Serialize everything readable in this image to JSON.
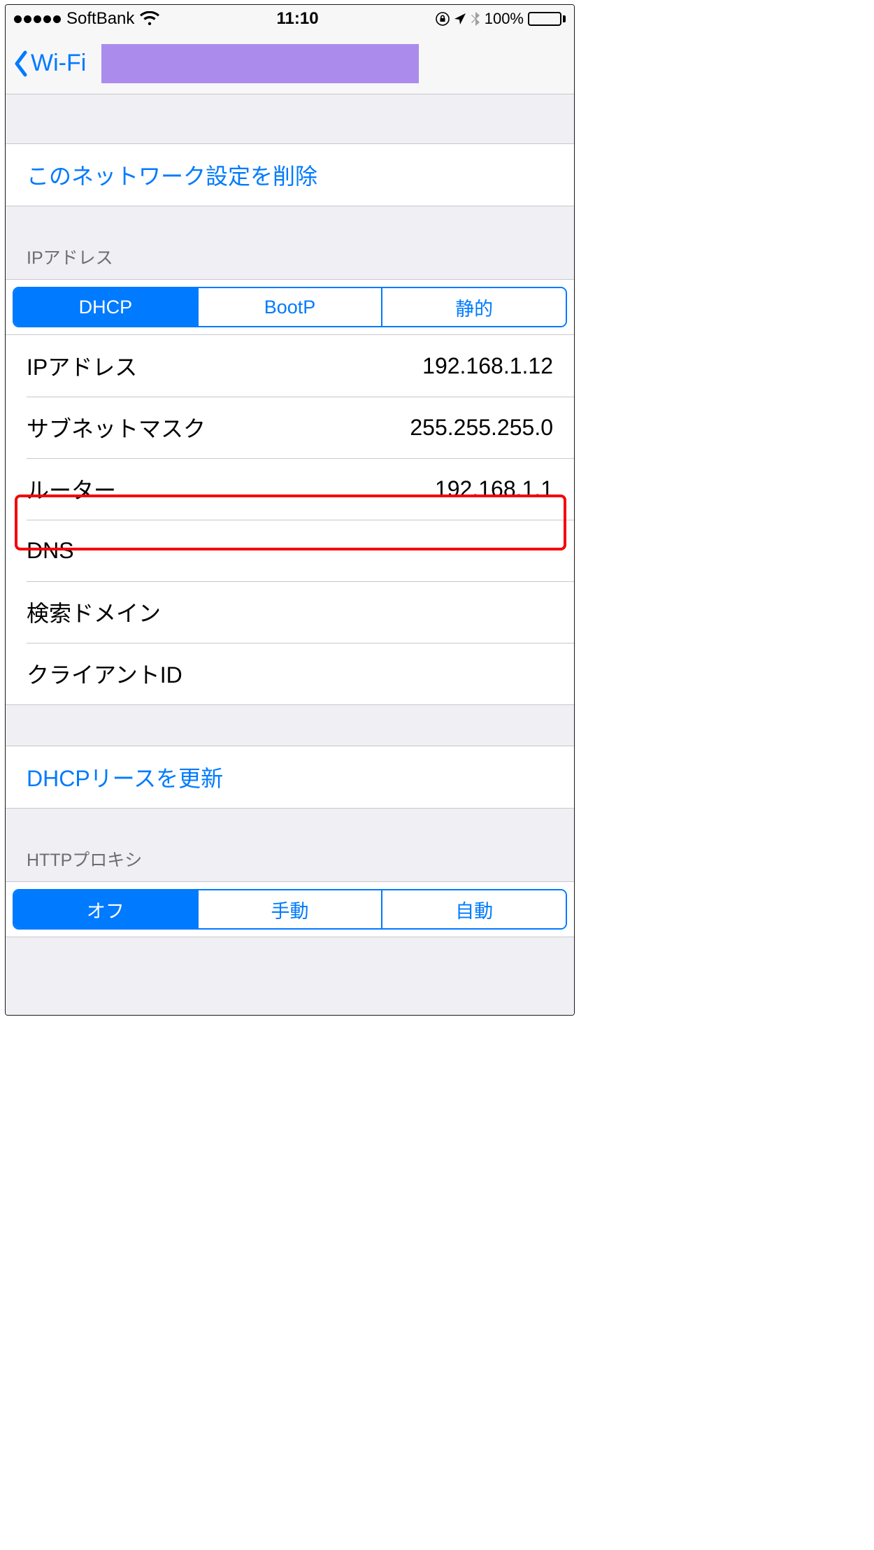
{
  "status": {
    "carrier": "SoftBank",
    "time": "11:10",
    "battery_pct": "100%"
  },
  "nav": {
    "back_label": "Wi-Fi"
  },
  "forget": {
    "label": "このネットワーク設定を削除"
  },
  "ip_section": {
    "header": "IPアドレス"
  },
  "ip_tabs": {
    "dhcp": "DHCP",
    "bootp": "BootP",
    "static": "静的"
  },
  "fields": {
    "ip_label": "IPアドレス",
    "ip_value": "192.168.1.12",
    "subnet_label": "サブネットマスク",
    "subnet_value": "255.255.255.0",
    "router_label": "ルーター",
    "router_value": "192.168.1.1",
    "dns_label": "DNS",
    "dns_value": "",
    "search_label": "検索ドメイン",
    "search_value": "",
    "client_label": "クライアントID",
    "client_value": ""
  },
  "renew": {
    "label": "DHCPリースを更新"
  },
  "proxy": {
    "header": "HTTPプロキシ",
    "off": "オフ",
    "manual": "手動",
    "auto": "自動"
  }
}
